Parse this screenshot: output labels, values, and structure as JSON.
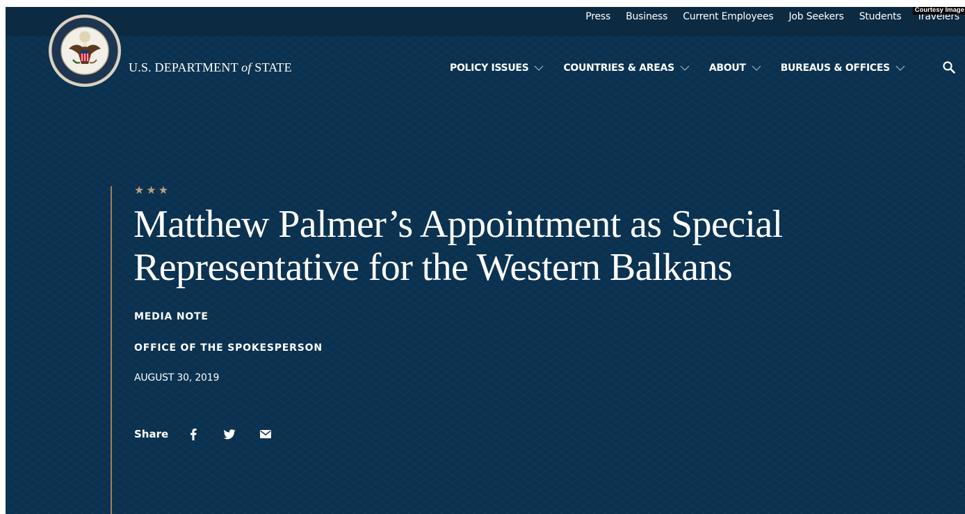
{
  "utility_nav": {
    "items": [
      "Press",
      "Business",
      "Current Employees",
      "Job Seekers",
      "Students",
      "Travelers"
    ]
  },
  "courtesy_badge": "Courtesy Image",
  "header": {
    "wordmark_part1": "U.S. DEPARTMENT ",
    "wordmark_italic": "of",
    "wordmark_part2": " STATE",
    "nav": [
      {
        "label": "POLICY ISSUES",
        "icon": "chevron-down-icon"
      },
      {
        "label": "COUNTRIES & AREAS",
        "icon": "chevron-down-icon"
      },
      {
        "label": "ABOUT",
        "icon": "chevron-down-icon"
      },
      {
        "label": "BUREAUS & OFFICES",
        "icon": "chevron-down-icon"
      }
    ],
    "search_icon": "search-icon"
  },
  "article": {
    "stars": "★★★",
    "headline": "Matthew Palmer’s Appointment as Special Representative for the Western Balkans",
    "type": "MEDIA NOTE",
    "office": "OFFICE OF THE SPOKESPERSON",
    "date": "AUGUST 30, 2019",
    "share_label": "Share",
    "share_icons": [
      "facebook-icon",
      "twitter-icon",
      "email-icon"
    ]
  },
  "colors": {
    "background": "#0a314f",
    "utility_bar": "#0c2a42",
    "accent_gold": "#a0825c",
    "stars": "#b79f82"
  }
}
